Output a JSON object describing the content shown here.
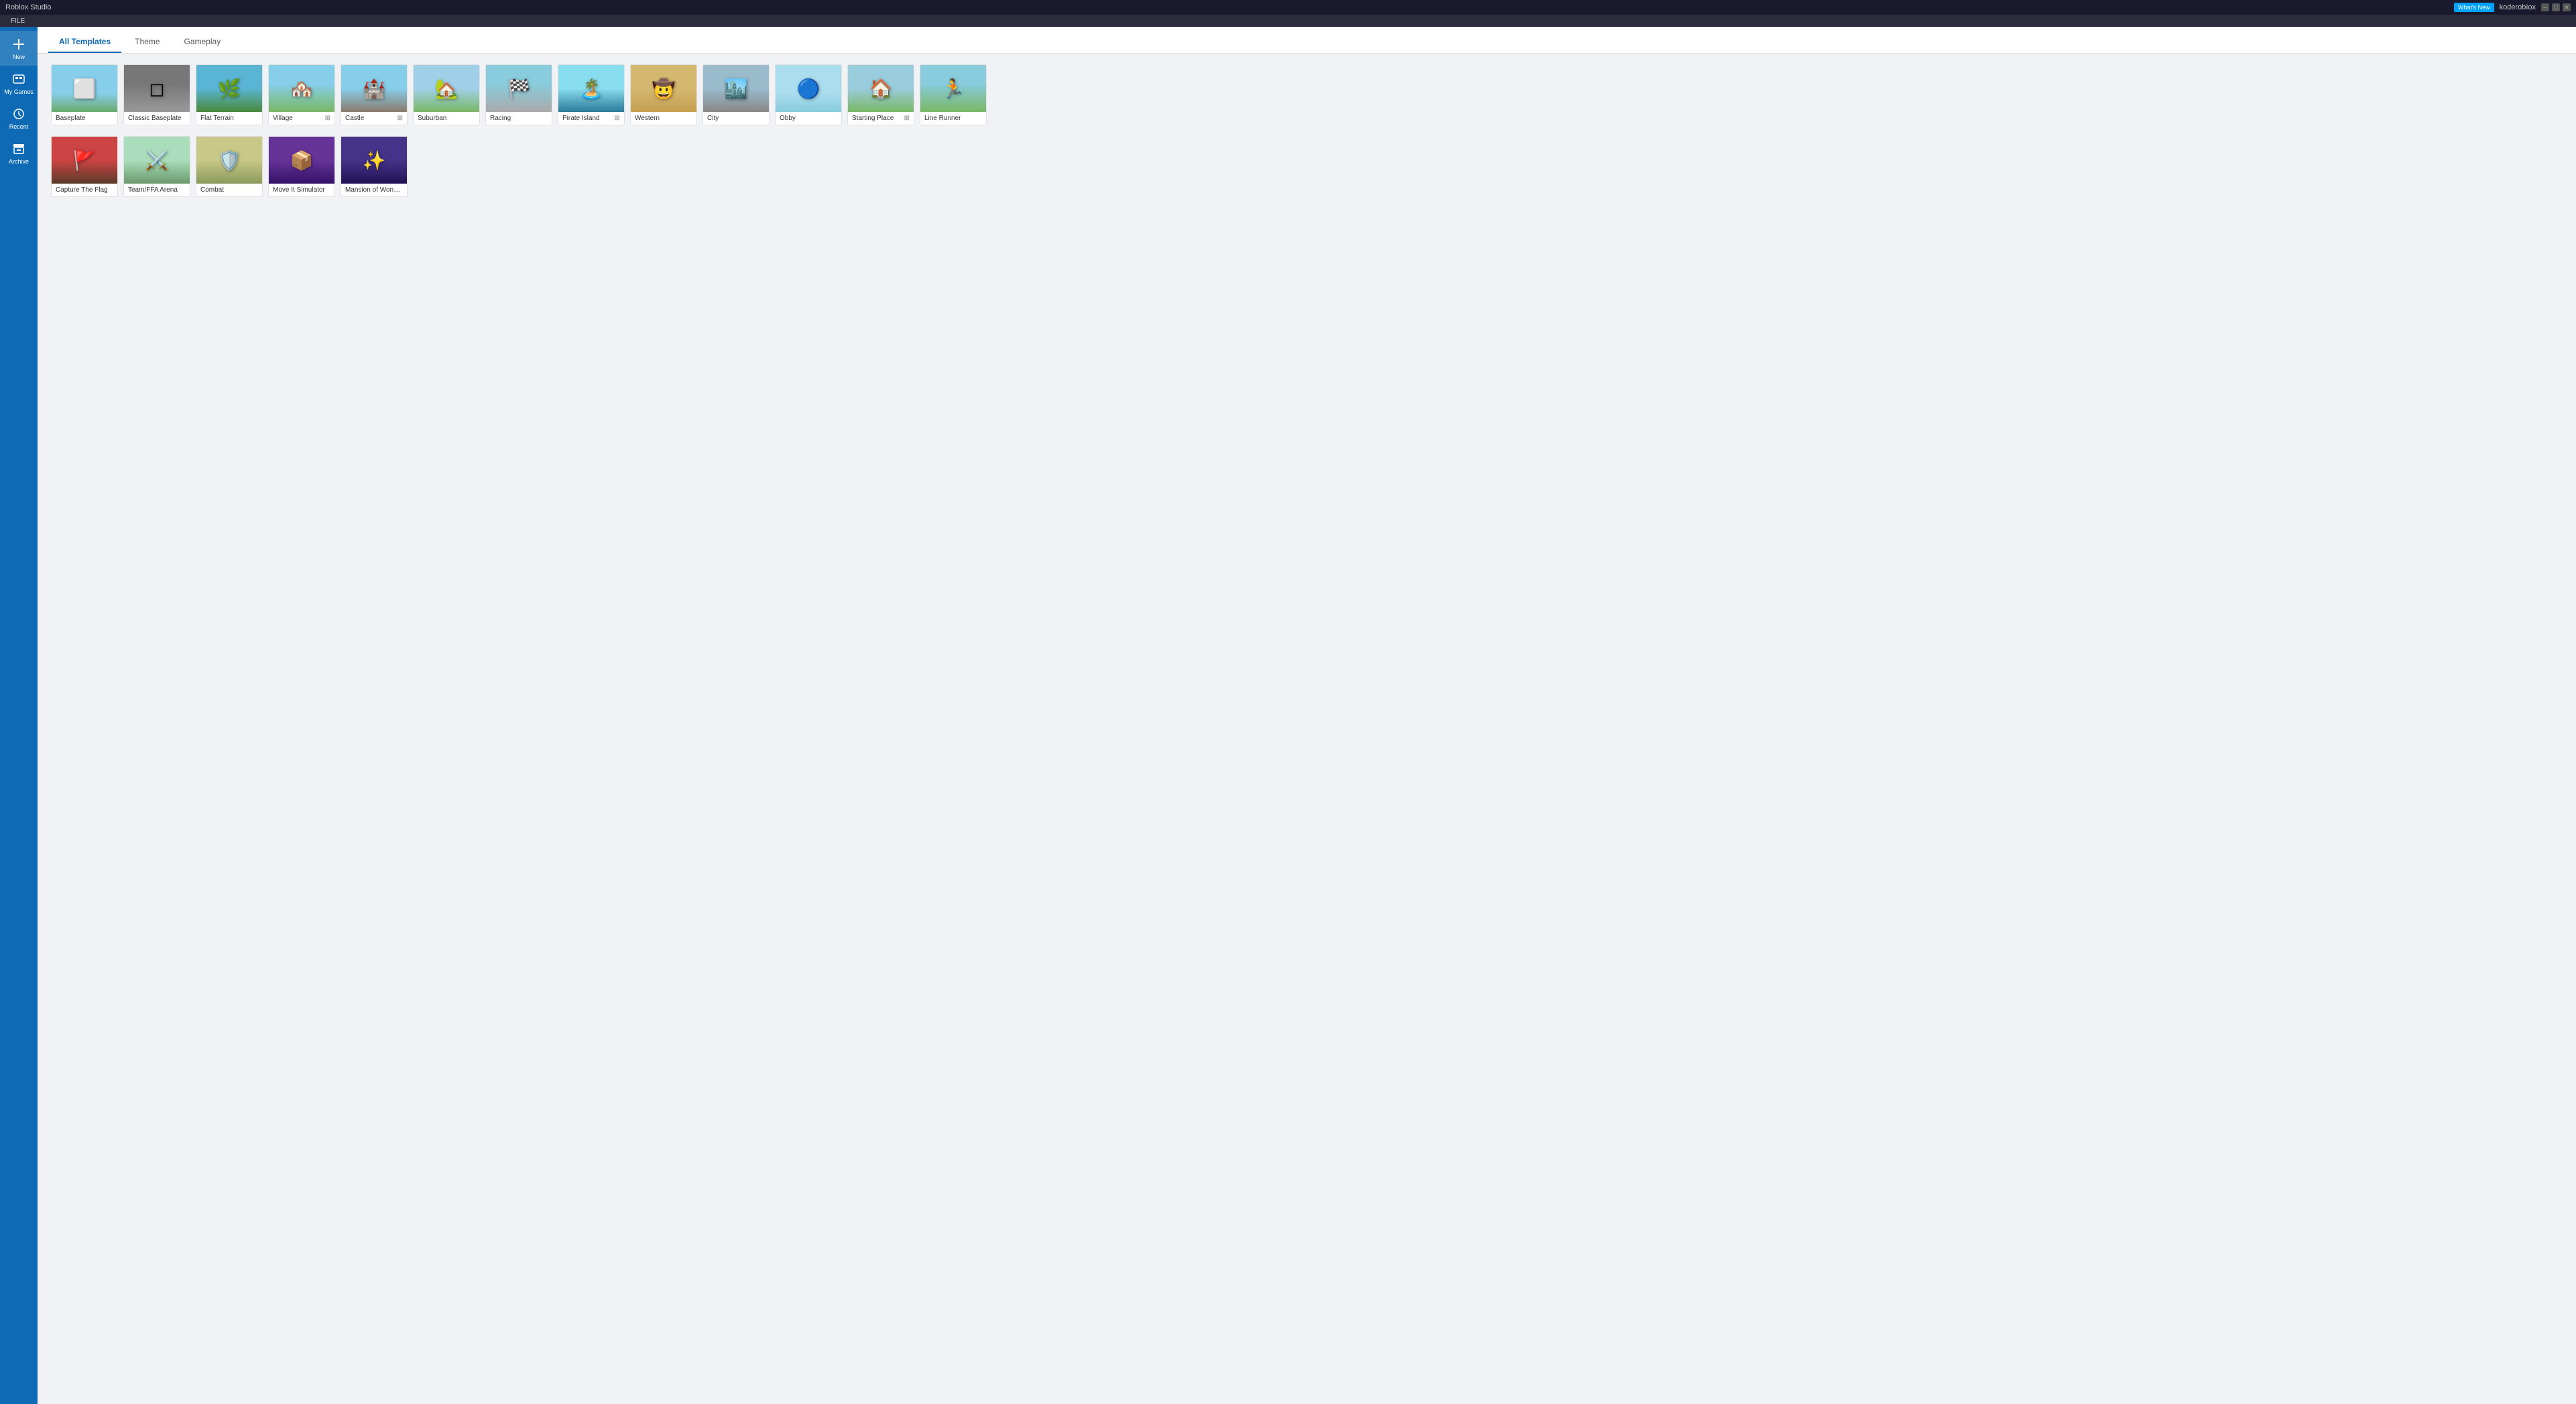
{
  "app": {
    "title": "Roblox Studio",
    "whats_new": "What's New",
    "username": "koderobIox"
  },
  "menu": {
    "items": [
      "FILE"
    ]
  },
  "sidebar": {
    "items": [
      {
        "id": "new",
        "label": "New",
        "icon": "➕"
      },
      {
        "id": "my-games",
        "label": "My Games",
        "icon": "🎮"
      },
      {
        "id": "recent",
        "label": "Recent",
        "icon": "🕐"
      },
      {
        "id": "archive",
        "label": "Archive",
        "icon": "📦"
      }
    ]
  },
  "tabs": [
    {
      "id": "all-templates",
      "label": "All Templates",
      "active": true
    },
    {
      "id": "theme",
      "label": "Theme",
      "active": false
    },
    {
      "id": "gameplay",
      "label": "Gameplay",
      "active": false
    }
  ],
  "templates": {
    "row1": [
      {
        "id": "baseplate",
        "name": "Baseplate",
        "thumb_class": "thumb-baseplate",
        "icon": "⬜",
        "has_info": false
      },
      {
        "id": "classic-baseplate",
        "name": "Classic Baseplate",
        "thumb_class": "thumb-classic-baseplate",
        "icon": "◻️",
        "has_info": false
      },
      {
        "id": "flat-terrain",
        "name": "Flat Terrain",
        "thumb_class": "thumb-flat-terrain",
        "icon": "🌿",
        "has_info": false
      },
      {
        "id": "village",
        "name": "Village",
        "thumb_class": "thumb-village",
        "icon": "🏘️",
        "has_info": true
      },
      {
        "id": "castle",
        "name": "Castle",
        "thumb_class": "thumb-castle",
        "icon": "🏰",
        "has_info": true
      },
      {
        "id": "suburban",
        "name": "Suburban",
        "thumb_class": "thumb-suburban",
        "icon": "🏡",
        "has_info": false
      },
      {
        "id": "racing",
        "name": "Racing",
        "thumb_class": "thumb-racing",
        "icon": "🏁",
        "has_info": false
      },
      {
        "id": "pirate-island",
        "name": "Pirate Island",
        "thumb_class": "thumb-pirate-island",
        "icon": "🏝️",
        "has_info": true
      },
      {
        "id": "western",
        "name": "Western",
        "thumb_class": "thumb-western",
        "icon": "🤠",
        "has_info": false
      },
      {
        "id": "city",
        "name": "City",
        "thumb_class": "thumb-city",
        "icon": "🏙️",
        "has_info": false
      },
      {
        "id": "obby",
        "name": "Obby",
        "thumb_class": "thumb-obby",
        "icon": "🔵",
        "has_info": false
      },
      {
        "id": "starting-place",
        "name": "Starting Place",
        "thumb_class": "thumb-starting-place",
        "icon": "🏠",
        "has_info": true
      },
      {
        "id": "line-runner",
        "name": "Line Runner",
        "thumb_class": "thumb-line-runner",
        "icon": "🏃",
        "has_info": false
      }
    ],
    "row2": [
      {
        "id": "capture-flag",
        "name": "Capture The Flag",
        "thumb_class": "thumb-capture-flag",
        "icon": "🚩",
        "has_info": false
      },
      {
        "id": "team-ffa",
        "name": "Team/FFA Arena",
        "thumb_class": "thumb-team-ffa",
        "icon": "⚔️",
        "has_info": false
      },
      {
        "id": "combat",
        "name": "Combat",
        "thumb_class": "thumb-combat",
        "icon": "🛡️",
        "has_info": false
      },
      {
        "id": "move-it",
        "name": "Move It Simulator",
        "thumb_class": "thumb-move-it",
        "icon": "📦",
        "has_info": false
      },
      {
        "id": "mansion",
        "name": "Mansion of Wonder",
        "thumb_class": "thumb-mansion",
        "icon": "✨",
        "has_info": false
      }
    ]
  }
}
